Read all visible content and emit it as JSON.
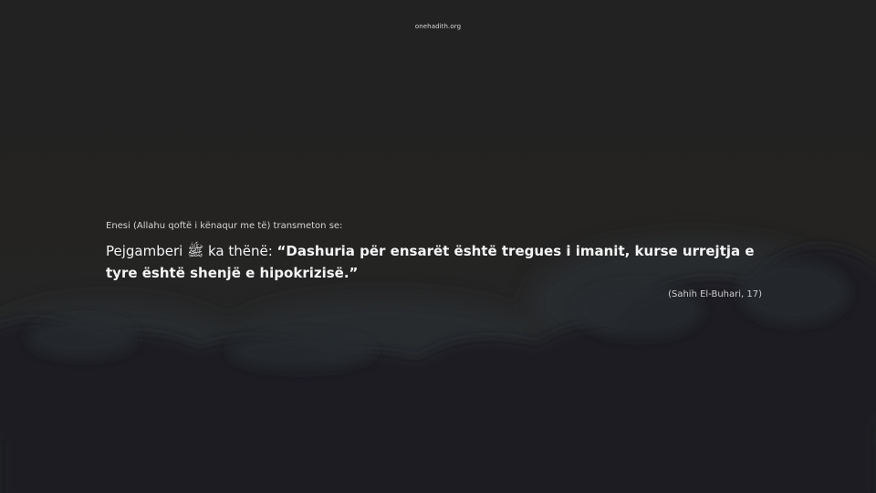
{
  "site": {
    "url": "onehadith.org"
  },
  "hadith": {
    "narrator_line": "Enesi (Allahu qoftë i kënaqur me të) transmeton se:",
    "prefix": "Pejgamberi ﷺ ka thënë: ",
    "quote": "“Dashuria për ensarët është tregues i imanit, kurse urrejtja e tyre është shenjë e hipokrizisë.”",
    "source": "(Sahih El-Buhari, 17)"
  },
  "colors": {
    "background": "#232323",
    "text": "#f4f4f4",
    "muted_text": "#d4d4d4",
    "cloud_dark": "#1a1d21",
    "cloud_mid": "#262a2f"
  }
}
